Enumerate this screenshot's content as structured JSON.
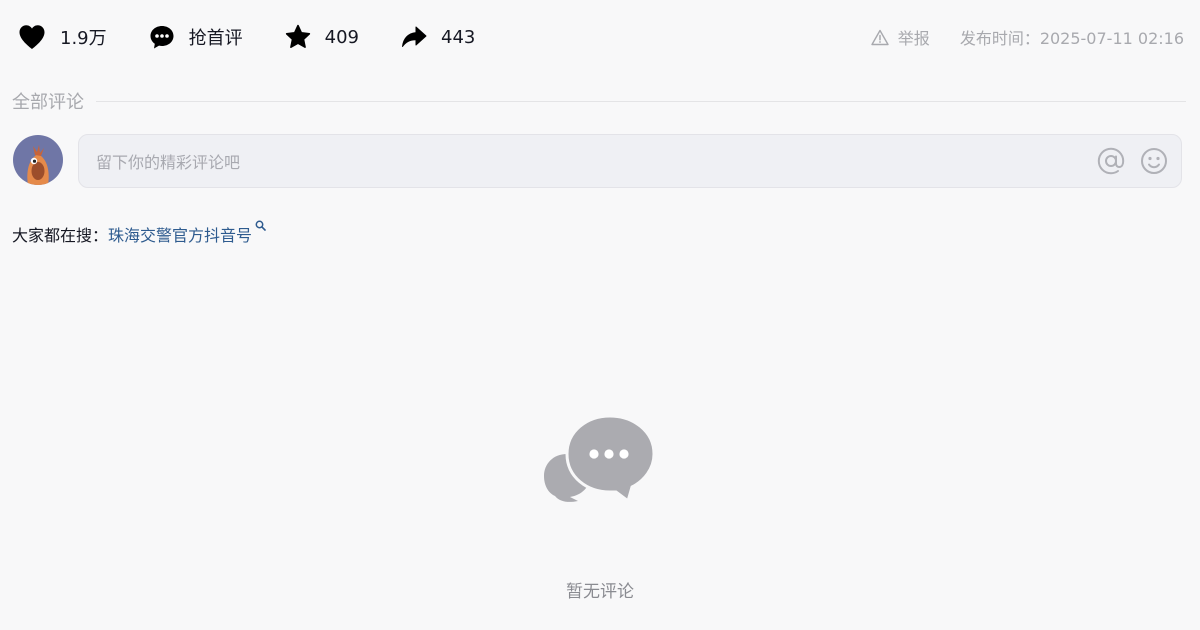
{
  "actions": {
    "like": {
      "icon": "heart-icon",
      "count": "1.9万"
    },
    "comment": {
      "icon": "comment-icon",
      "label": "抢首评"
    },
    "favorite": {
      "icon": "star-icon",
      "count": "409"
    },
    "share": {
      "icon": "share-arrow-icon",
      "count": "443"
    }
  },
  "meta": {
    "report_icon": "warning-triangle-icon",
    "report_label": "举报",
    "publish_time": "发布时间：2025-07-11 02:16"
  },
  "comments": {
    "title": "全部评论",
    "input_placeholder": "留下你的精彩评论吧",
    "input_value": "",
    "at_icon": "at-sign-icon",
    "emoji_icon": "smiley-emoji-icon"
  },
  "hot_search": {
    "prefix": "大家都在搜：",
    "link_text": "珠海交警官方抖音号",
    "link_icon": "search-icon"
  },
  "empty_state": {
    "icon": "chat-bubbles-icon",
    "text": "暂无评论"
  },
  "colors": {
    "background": "#f8f8f9",
    "link": "#2e5b8f",
    "muted_text": "#a8a9ae",
    "empty_icon": "#ababb0",
    "avatar_background": "#6f76a6",
    "avatar_character": "#e58a4a"
  }
}
